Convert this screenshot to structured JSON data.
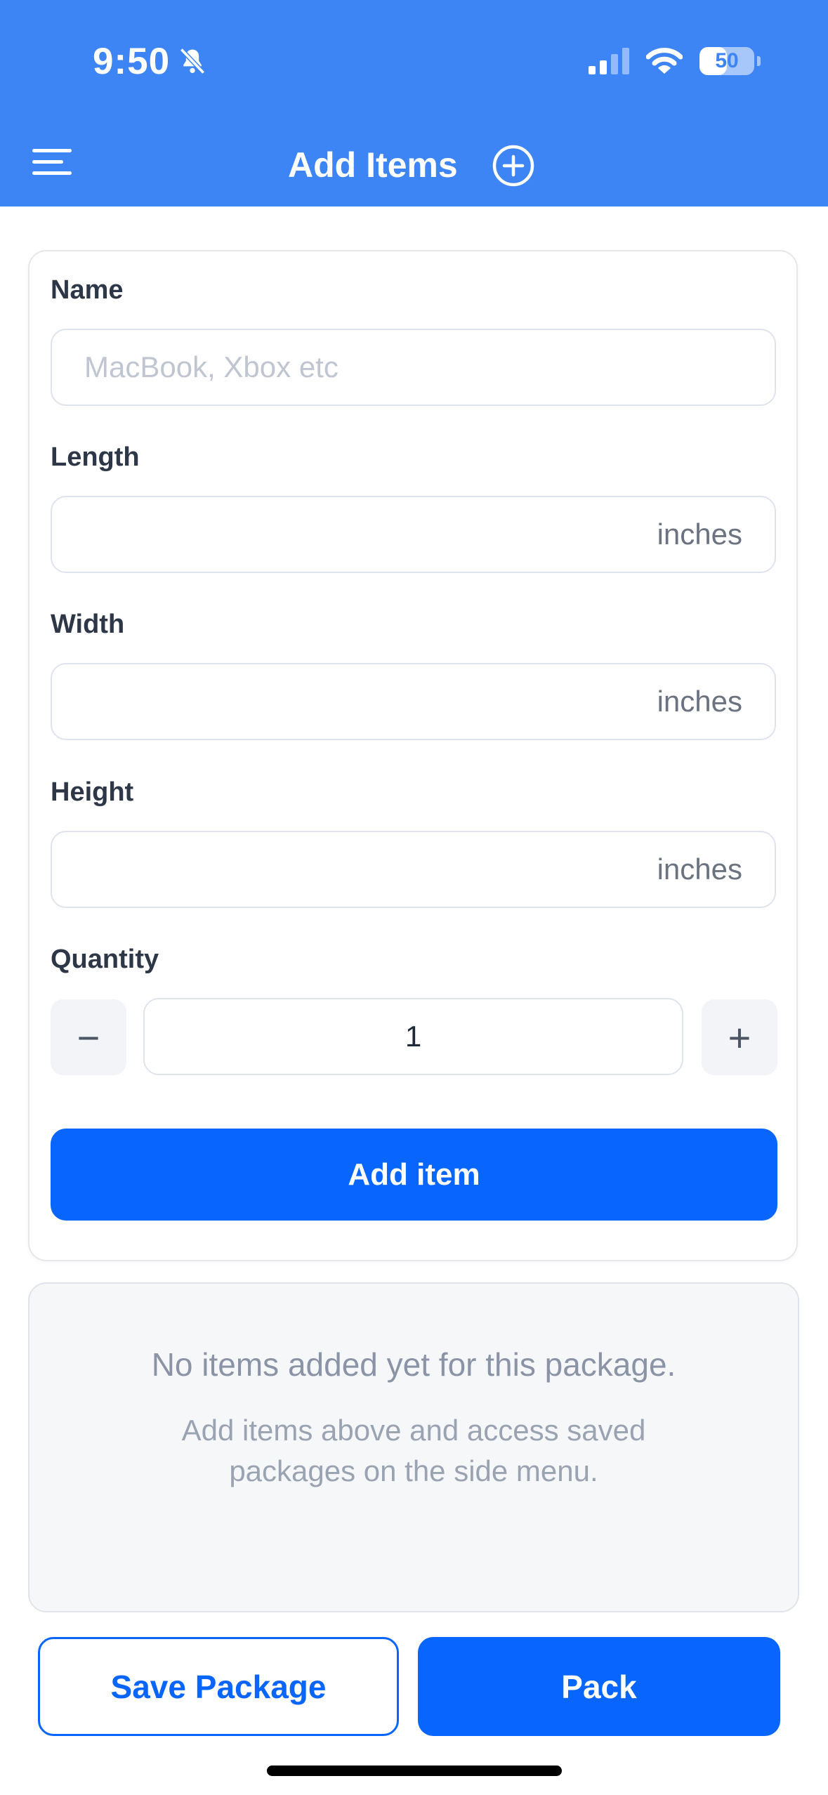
{
  "status_bar": {
    "time": "9:50",
    "silent_icon": "bell-slash-icon",
    "signal_icon": "cellular-signal-icon",
    "wifi_icon": "wifi-icon",
    "battery_level": "50"
  },
  "nav": {
    "menu_icon": "hamburger-menu-icon",
    "title": "Add Items",
    "add_icon": "plus-circle-icon"
  },
  "form": {
    "name": {
      "label": "Name",
      "placeholder": "MacBook, Xbox etc",
      "value": ""
    },
    "length": {
      "label": "Length",
      "unit": "inches",
      "value": ""
    },
    "width": {
      "label": "Width",
      "unit": "inches",
      "value": ""
    },
    "height": {
      "label": "Height",
      "unit": "inches",
      "value": ""
    },
    "quantity": {
      "label": "Quantity",
      "value": "1",
      "decrement": "−",
      "increment": "+"
    },
    "add_button": "Add item"
  },
  "empty_state": {
    "title": "No items added yet for this package.",
    "subtitle": "Add items above and access saved packages on the side menu."
  },
  "actions": {
    "save": "Save Package",
    "pack": "Pack"
  },
  "colors": {
    "header": "#3d84f5",
    "primary": "#0866ff"
  }
}
